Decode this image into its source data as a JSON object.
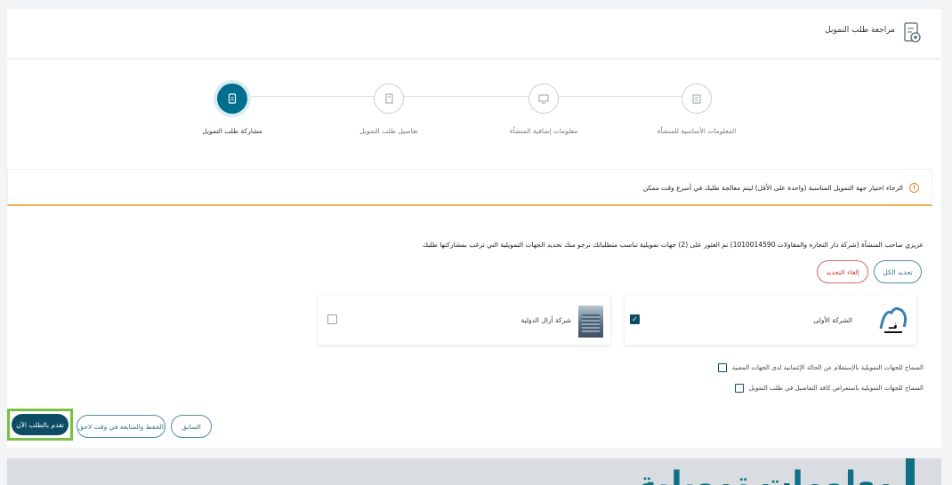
{
  "header": {
    "title": "مراجعة طلب التمويل",
    "icon": "document-gear-icon"
  },
  "steps": [
    {
      "label": "المعلومات الأساسية للمنشأة",
      "icon": "building-icon",
      "state": "inactive"
    },
    {
      "label": "معلومات إضافية المنشأة",
      "icon": "monitor-icon",
      "state": "inactive"
    },
    {
      "label": "تفاصيل طلب التمويل",
      "icon": "form-icon",
      "state": "inactive"
    },
    {
      "label": "مشاركة طلب التمويل",
      "icon": "document-icon",
      "state": "active"
    }
  ],
  "alert": {
    "text": "الرجاء اختيار جهة التمويل المناسبة (واحدة على الأقل) ليتم معالجة طلبك في أسرع وقت ممكن",
    "icon": "info-icon",
    "accent": "#f0b04a"
  },
  "description": "عزيزي صاحب المنشأة (شركة دار التجاره والمقاولات 1010014590) تم العثور على (2) جهات تمويلية تناسب متطلباتك نرجو منك تحديد الجهات التمويلية التي ترغب بمشاركتها طلبك",
  "selection": {
    "select_all": "تحديد الكل",
    "deselect": "إلغاء التحديد"
  },
  "funders": [
    {
      "name": "الشركة الأولى",
      "checked": true,
      "logo": "company-logo-1"
    },
    {
      "name": "شركة أزال الدولية",
      "checked": false,
      "logo": "building-photo"
    }
  ],
  "consents": [
    "السماح للجهات التمويلية بالإستعلام عن الحالة الإئتمانية لدى الجهات المعنية",
    "السماح للجهات التمويلية باستعراض كافة التفاصيل في طلب التمويل"
  ],
  "actions": {
    "previous": "السابق",
    "save_later": "الحفظ والمتابعة في وقت لاحق",
    "submit": "تقدم بالطلب الآن"
  },
  "colors": {
    "primary": "#0d4d63",
    "teal": "#006e8c",
    "highlight": "#77c043",
    "danger": "#c0392b"
  },
  "footer": {
    "heading": "معلومات تمويلية"
  }
}
